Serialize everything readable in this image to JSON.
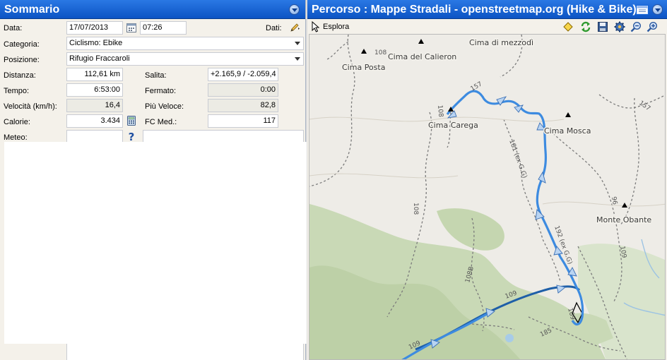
{
  "summary": {
    "title": "Sommario",
    "labels": {
      "data": "Data:",
      "dati": "Dati:",
      "categoria": "Categoria:",
      "posizione": "Posizione:",
      "distanza": "Distanza:",
      "salita": "Salita:",
      "tempo": "Tempo:",
      "fermato": "Fermato:",
      "velocita": "Velocità (km/h):",
      "piu_veloce": "Più Veloce:",
      "calorie": "Calorie:",
      "fc_med": "FC Med.:",
      "meteo": "Meteo:"
    },
    "values": {
      "date": "17/07/2013",
      "time": "07:26",
      "categoria": "Ciclismo: Ebike",
      "posizione": "Rifugio Fraccaroli",
      "distanza": "112,61 km",
      "salita": "+2.165,9 / -2.059,4",
      "tempo": "6:53:00",
      "fermato": "0:00",
      "velocita": "16,4",
      "piu_veloce": "82,8",
      "calorie": "3.434",
      "fc_med": "117",
      "meteo": ""
    }
  },
  "route": {
    "title": "Percorso  : Mappe Stradali - openstreetmap.org (Hike & Bike)",
    "explore_label": "Esplora",
    "toolbar_icons": [
      "diamond-icon",
      "refresh-icon",
      "save-icon",
      "settings-icon",
      "zoom-out-icon",
      "zoom-in-icon"
    ],
    "map_labels": {
      "cima_posta": "Cima Posta",
      "cima_calieron": "Cima del Calieron",
      "cima_mezzodi": "Cima di mezzodì",
      "cima_carega": "Cima Carega",
      "cima_mosca": "Cima Mosca",
      "monte_obante": "Monte Obante",
      "trail_108a": "108",
      "trail_108b": "108",
      "trail_108c": "108",
      "trail_108d": "108B",
      "trail_157a": "157",
      "trail_157b": "157",
      "trail_181": "181 (ex G.G)",
      "trail_96": "96",
      "trail_192": "192 (ex G.G)",
      "trail_109a": "109",
      "trail_109b": "109",
      "trail_109c": "109",
      "trail_109d": "109",
      "trail_185": "185"
    }
  },
  "colors": {
    "title_bar": "#1565d8",
    "track": "#3d8be0",
    "road": "#1e5fa8",
    "forest": "#c5d6b0",
    "rock": "#ede9e1"
  }
}
